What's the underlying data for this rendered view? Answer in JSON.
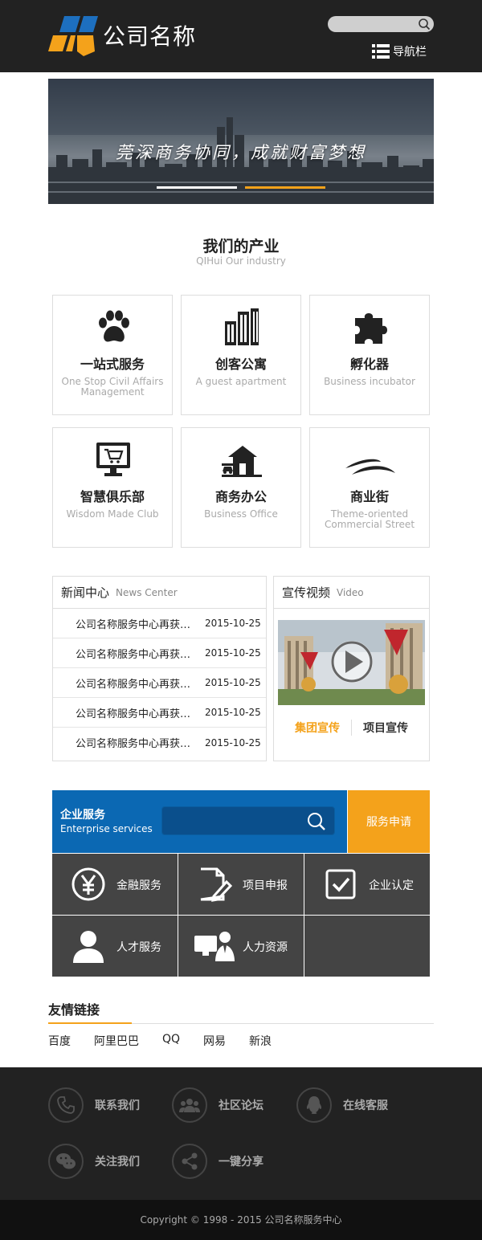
{
  "header": {
    "company_name": "公司名称",
    "nav_label": "导航栏",
    "search_placeholder": ""
  },
  "banner": {
    "slogan": "莞深商务协同，成就财富梦想",
    "slides": 2,
    "active_slide": 2
  },
  "industry": {
    "title": "我们的产业",
    "subtitle": "QIHui Our industry",
    "cards": [
      {
        "icon": "paw-icon",
        "title": "一站式服务",
        "sub": "One Stop Civil Affairs Management"
      },
      {
        "icon": "building-icon",
        "title": "创客公寓",
        "sub": "A guest apartment"
      },
      {
        "icon": "puzzle-icon",
        "title": "孵化器",
        "sub": "Business incubator"
      },
      {
        "icon": "monitor-cart-icon",
        "title": "智慧俱乐部",
        "sub": "Wisdom Made Club"
      },
      {
        "icon": "house-car-icon",
        "title": "商务办公",
        "sub": "Business Office"
      },
      {
        "icon": "road-swoosh-icon",
        "title": "商业街",
        "sub": "Theme-oriented Commercial Street"
      }
    ]
  },
  "news": {
    "title": "新闻中心",
    "subtitle": "News Center",
    "items": [
      {
        "title": "公司名称服务中心再获殊荣",
        "date": "2015-10-25"
      },
      {
        "title": "公司名称服务中心再获殊荣",
        "date": "2015-10-25"
      },
      {
        "title": "公司名称服务中心再获殊荣",
        "date": "2015-10-25"
      },
      {
        "title": "公司名称服务中心再获殊荣",
        "date": "2015-10-25"
      },
      {
        "title": "公司名称服务中心再获殊荣",
        "date": "2015-10-25"
      }
    ]
  },
  "video": {
    "title": "宣传视频",
    "subtitle": "Video",
    "link1": "集团宣传",
    "link2": "项目宣传"
  },
  "enterprise": {
    "title": "企业服务",
    "subtitle": "Enterprise services",
    "apply_label": "服务申请",
    "services": [
      {
        "icon": "yen-icon",
        "label": "金融服务"
      },
      {
        "icon": "document-pen-icon",
        "label": "项目申报"
      },
      {
        "icon": "checkbox-icon",
        "label": "企业认定"
      },
      {
        "icon": "person-icon",
        "label": "人才服务"
      },
      {
        "icon": "team-monitor-icon",
        "label": "人力资源"
      }
    ]
  },
  "links": {
    "title": "友情链接",
    "items": [
      "百度",
      "阿里巴巴",
      "QQ",
      "网易",
      "新浪"
    ]
  },
  "footer": {
    "items": [
      {
        "icon": "phone-icon",
        "label": "联系我们"
      },
      {
        "icon": "community-icon",
        "label": "社区论坛"
      },
      {
        "icon": "qq-penguin-icon",
        "label": "在线客服"
      },
      {
        "icon": "wechat-icon",
        "label": "关注我们"
      },
      {
        "icon": "share-icon",
        "label": "一键分享"
      }
    ],
    "copyright": "Copyright © 1998 - 2015 公司名称服务中心"
  },
  "colors": {
    "accent": "#f4a21b",
    "brand_blue": "#0b68b3",
    "logo_blue": "#1d6fbf",
    "dark": "#222222",
    "tile": "#444444"
  }
}
